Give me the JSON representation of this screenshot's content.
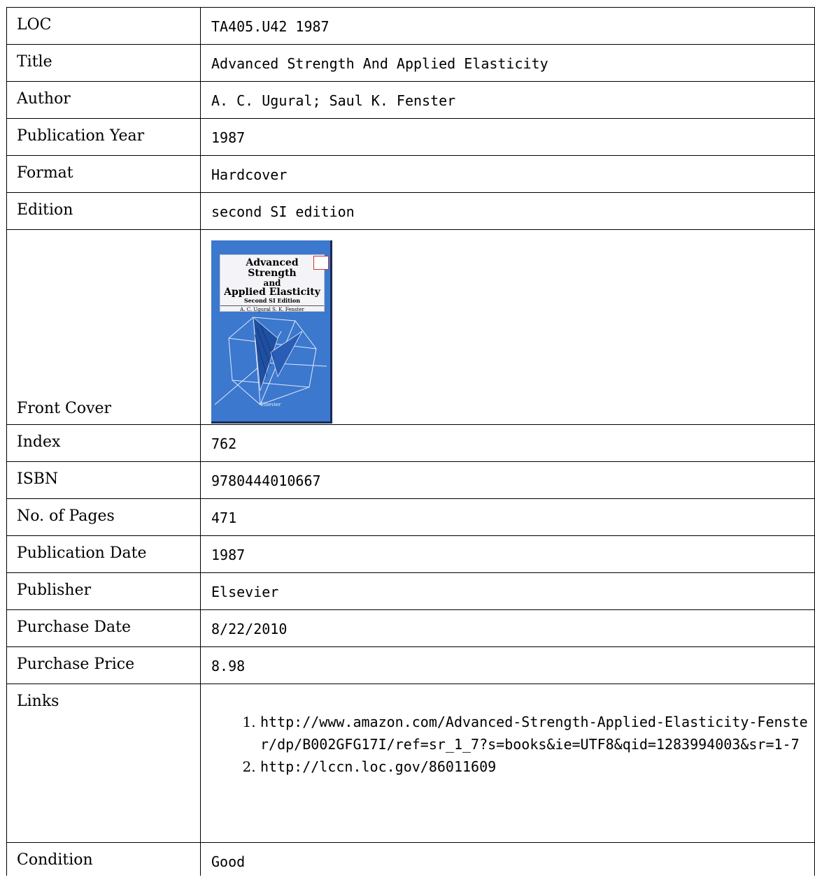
{
  "rows": {
    "loc": {
      "label": "LOC",
      "value": "TA405.U42 1987"
    },
    "title": {
      "label": "Title",
      "value": "Advanced Strength And Applied Elasticity"
    },
    "author": {
      "label": "Author",
      "value": "A. C. Ugural; Saul K. Fenster"
    },
    "publication_year": {
      "label": "Publication Year",
      "value": "1987"
    },
    "format": {
      "label": "Format",
      "value": "Hardcover"
    },
    "edition": {
      "label": "Edition",
      "value": "second SI edition"
    },
    "front_cover": {
      "label": "Front Cover"
    },
    "index": {
      "label": "Index",
      "value": "762"
    },
    "isbn": {
      "label": "ISBN",
      "value": "9780444010667"
    },
    "pages": {
      "label": "No. of Pages",
      "value": "471"
    },
    "publication_date": {
      "label": "Publication Date",
      "value": "1987"
    },
    "publisher": {
      "label": "Publisher",
      "value": "Elsevier"
    },
    "purchase_date": {
      "label": "Purchase Date",
      "value": "8/22/2010"
    },
    "purchase_price": {
      "label": "Purchase Price",
      "value": "8.98"
    },
    "links": {
      "label": "Links",
      "items": [
        "http://www.amazon.com/Advanced-Strength-Applied-Elasticity-Fenster/dp/B002GFG17I/ref=sr_1_7?s=books&ie=UTF8&qid=1283994003&sr=1-7",
        "http://lccn.loc.gov/86011609"
      ]
    },
    "condition": {
      "label": "Condition",
      "value": "Good"
    }
  },
  "cover": {
    "line1": "Advanced Strength",
    "line2": "and",
    "line3": "Applied Elasticity",
    "line4": "Second SI Edition",
    "authors": "A. C. Ugural   S. K. Fenster",
    "publisher": "Elsevier",
    "colors": {
      "background": "#3c78cd",
      "label": "#f4f4f8"
    }
  }
}
